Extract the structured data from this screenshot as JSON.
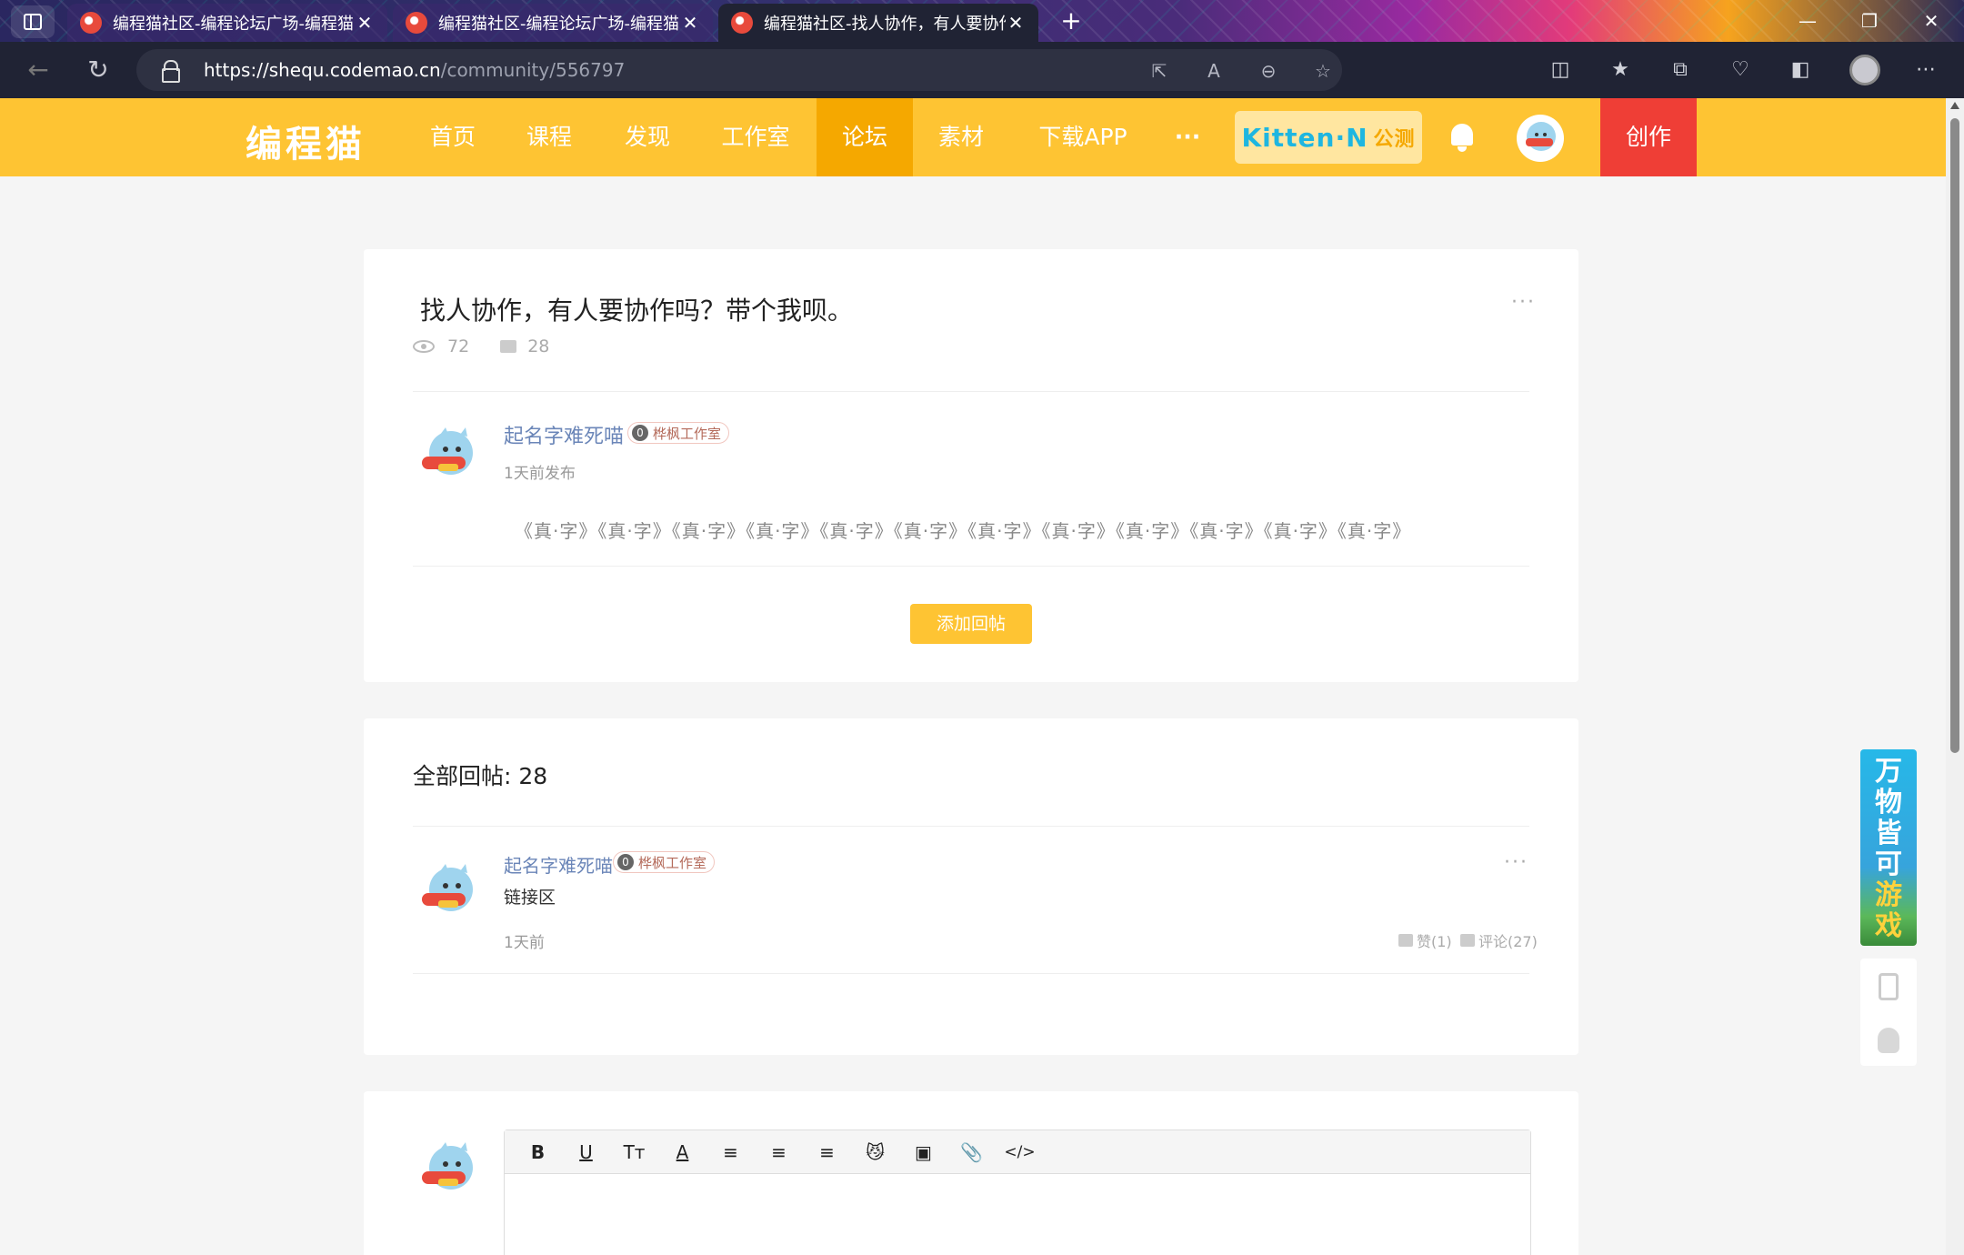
{
  "browser": {
    "tabs": [
      {
        "title": "编程猫社区-编程论坛广场-编程猫"
      },
      {
        "title": "编程猫社区-编程论坛广场-编程猫"
      },
      {
        "title": "编程猫社区-找人协作，有人要协作吗？带个我呗。"
      }
    ],
    "new_tab_glyph": "+",
    "url_domain": "https://shequ.codemao.cn",
    "url_path": "/community/556797"
  },
  "site": {
    "logo": "编程猫",
    "nav": [
      "首页",
      "课程",
      "发现",
      "工作室",
      "论坛",
      "素材",
      "下载APP",
      "···"
    ],
    "active_nav": "论坛",
    "kitten_label": "Kitten·N",
    "kitten_tag": "公测",
    "create_label": "创作"
  },
  "post": {
    "title": "找人协作，有人要协作吗？带个我呗。",
    "views": "72",
    "comments": "28",
    "author": "起名字难死喵",
    "author_level": "0",
    "author_studio": "桦枫工作室",
    "time": "1天前发布",
    "body": "《真·字》《真·字》《真·字》《真·字》《真·字》《真·字》《真·字》《真·字》《真·字》《真·字》《真·字》《真·字》",
    "reply_button": "添加回帖"
  },
  "replies": {
    "title": "全部回帖: 28",
    "items": [
      {
        "author": "起名字难死喵",
        "level": "0",
        "studio": "桦枫工作室",
        "text": "链接区",
        "time": "1天前",
        "likes": "赞(1)",
        "comments": "评论(27)"
      }
    ]
  },
  "editor": {
    "tools": [
      "B",
      "U",
      "Tт",
      "A",
      "≡",
      "≡",
      "≡",
      "😼",
      "▣",
      "📎",
      "</>"
    ]
  },
  "side": {
    "promo_lines": [
      "万",
      "物",
      "皆",
      "可",
      "游",
      "戏"
    ]
  },
  "colors": {
    "brand_yellow": "#fec433",
    "active_nav": "#f5a800",
    "create_red": "#ef3e36",
    "author_blue": "#6b86b8"
  }
}
